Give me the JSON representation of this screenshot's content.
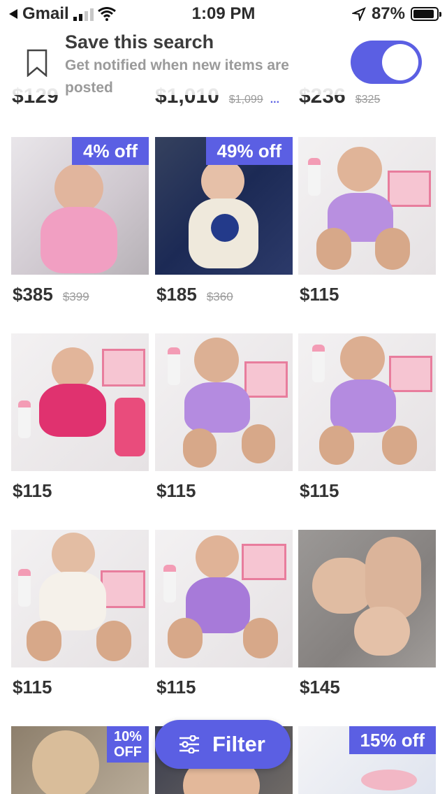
{
  "status_bar": {
    "back_app": "Gmail",
    "time": "1:09 PM",
    "battery": "87%"
  },
  "banner": {
    "title": "Save this search",
    "subtitle": "Get notified when new items are posted",
    "toggle_on": true
  },
  "peek_row": [
    {
      "price": "$129",
      "original": ""
    },
    {
      "price": "$1,010",
      "original": "$1,099",
      "more": "..."
    },
    {
      "price": "$236",
      "original": "$325"
    }
  ],
  "items": [
    {
      "price": "$385",
      "original": "$399",
      "badge": "4% off"
    },
    {
      "price": "$185",
      "original": "$360",
      "badge": "49% off"
    },
    {
      "price": "$115",
      "original": "",
      "badge": ""
    },
    {
      "price": "$115",
      "original": "",
      "badge": ""
    },
    {
      "price": "$115",
      "original": "",
      "badge": ""
    },
    {
      "price": "$115",
      "original": "",
      "badge": ""
    },
    {
      "price": "$115",
      "original": "",
      "badge": ""
    },
    {
      "price": "$115",
      "original": "",
      "badge": ""
    },
    {
      "price": "$145",
      "original": "",
      "badge": ""
    },
    {
      "price": "",
      "original": "",
      "badge_line1": "10%",
      "badge_line2": "OFF"
    },
    {
      "price": "",
      "original": "",
      "badge": ""
    },
    {
      "price": "",
      "original": "",
      "badge": "15% off"
    }
  ],
  "filter_button": {
    "label": "Filter",
    "icon": "sliders-icon"
  },
  "colors": {
    "accent": "#5b5fe3",
    "price_text": "#333333",
    "strike_text": "#9a9a9a"
  }
}
